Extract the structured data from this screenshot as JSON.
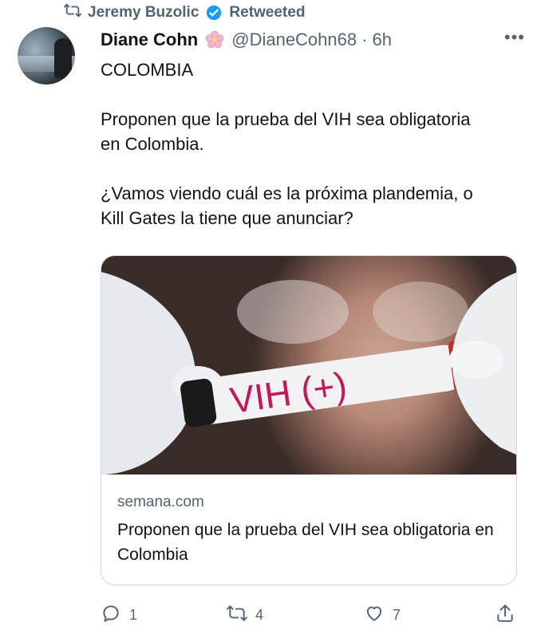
{
  "retweet": {
    "icon": "retweet-icon",
    "user": "Jeremy Buzolic",
    "verified_icon": "verified-badge-icon",
    "label": "Retweeted"
  },
  "tweet": {
    "author_name": "Diane Cohn",
    "name_emoji_icon": "cherry-blossom-icon",
    "handle": "@DianeCohn68",
    "separator": "·",
    "time": "6h",
    "more_label": "•••",
    "text": "COLOMBIA\n\nProponen que la prueba del VIH sea obligatoria\nen Colombia.\n\n¿Vamos viendo cuál es la próxima plandemia, o\nKill Gates la tiene que anunciar?"
  },
  "card": {
    "image_text": "VIH (+)",
    "domain": "semana.com",
    "title": "Proponen que la prueba del VIH sea obligatoria en Colombia"
  },
  "actions": {
    "reply_count": "1",
    "retweet_count": "4",
    "like_count": "7"
  },
  "colors": {
    "secondary_text": "#536471",
    "border": "#cfd9de",
    "verified_blue": "#1d9bf0"
  }
}
